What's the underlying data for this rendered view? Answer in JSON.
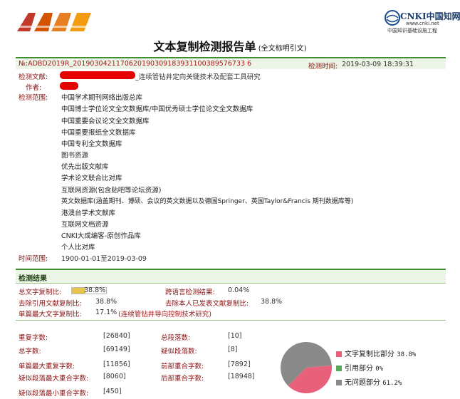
{
  "header": {
    "report_title": "文本复制检测报告单",
    "report_subtitle": "(全文标明引文)",
    "cnki_logo_text": "CNKI中国知网",
    "cnki_url": "www.cnki.net",
    "cnki_tagline": "中国知识基础设施工程"
  },
  "report": {
    "id": "№:ADBD2019R_2019030421170620190309183931100389576733 6",
    "time_label": "检测时间:",
    "time_value": "2019-03-09 18:39:31",
    "doc_label": "检测文献:",
    "doc_title": "_连续管钻井定向关键技术及配套工具研究",
    "author_label": "作者:",
    "scope_label": "检测范围:",
    "databases": [
      "中国学术期刊网络出版总库",
      "中国博士学位论文全文数据库/中国优秀硕士学位论文全文数据库",
      "中国重要会议论文全文数据库",
      "中国重要报纸全文数据库",
      "中国专利全文数据库",
      "图书资源",
      "优先出版文献库",
      "学术论文联合比对库",
      "互联网资源(包含贴吧等论坛资源)",
      "英文数据库(涵盖期刊、博硕、会议的英文数据以及德国Springer、英国Taylor&Francis 期刊数据库等)",
      "港澳台学术文献库",
      "互联网文档资源",
      "CNKI大成编客-原创作品库",
      "个人比对库"
    ],
    "range_label": "时间范围:",
    "range_value": "1900-01-01至2019-03-09"
  },
  "results": {
    "section_title": "检测结果",
    "total_label": "总文字复制比:",
    "total_value": "38.8%",
    "total_fraction": 0.388,
    "cross_lang_label": "跨语言检测结果:",
    "cross_lang_value": "0.04%",
    "excl_ref_label": "去除引用文献复制比:",
    "excl_ref_value": "38.8%",
    "excl_self_label": "去除本人已发表文献复制比:",
    "excl_self_value": "38.8%",
    "single_max_label": "单篇最大文字复制比:",
    "single_max_value": "17.1%",
    "single_max_source": "(连续管钻井导向控制技术研究)"
  },
  "stats": {
    "repeat_chars_label": "重复字数:",
    "repeat_chars_value": "[26840]",
    "total_paragraphs_label": "总段落数:",
    "total_paragraphs_value": "[10]",
    "total_chars_label": "总字数:",
    "total_chars_value": "[69149]",
    "suspect_paragraphs_label": "疑似段落数:",
    "suspect_paragraphs_value": "[8]",
    "single_max_repeat_label": "单篇最大重复字数:",
    "single_max_repeat_value": "[11856]",
    "front_overlap_label": "前部重合字数:",
    "front_overlap_value": "[7892]",
    "suspect_max_overlap_label": "疑似段落最大重合字数:",
    "suspect_max_overlap_value": "[8060]",
    "back_overlap_label": "后部重合字数:",
    "back_overlap_value": "[18948]",
    "suspect_min_overlap_label": "疑似段落最小重合字数:",
    "suspect_min_overlap_value": "[450]"
  },
  "chart_data": {
    "type": "pie",
    "series": [
      {
        "name": "文字复制比部分",
        "value": 38.8,
        "display": "38.8%",
        "color": "#e8607a"
      },
      {
        "name": "引用部分",
        "value": 0,
        "display": "0%",
        "color": "#5aa95a"
      },
      {
        "name": "无问题部分",
        "value": 61.2,
        "display": "61.2%",
        "color": "#8a8a8a"
      }
    ]
  }
}
